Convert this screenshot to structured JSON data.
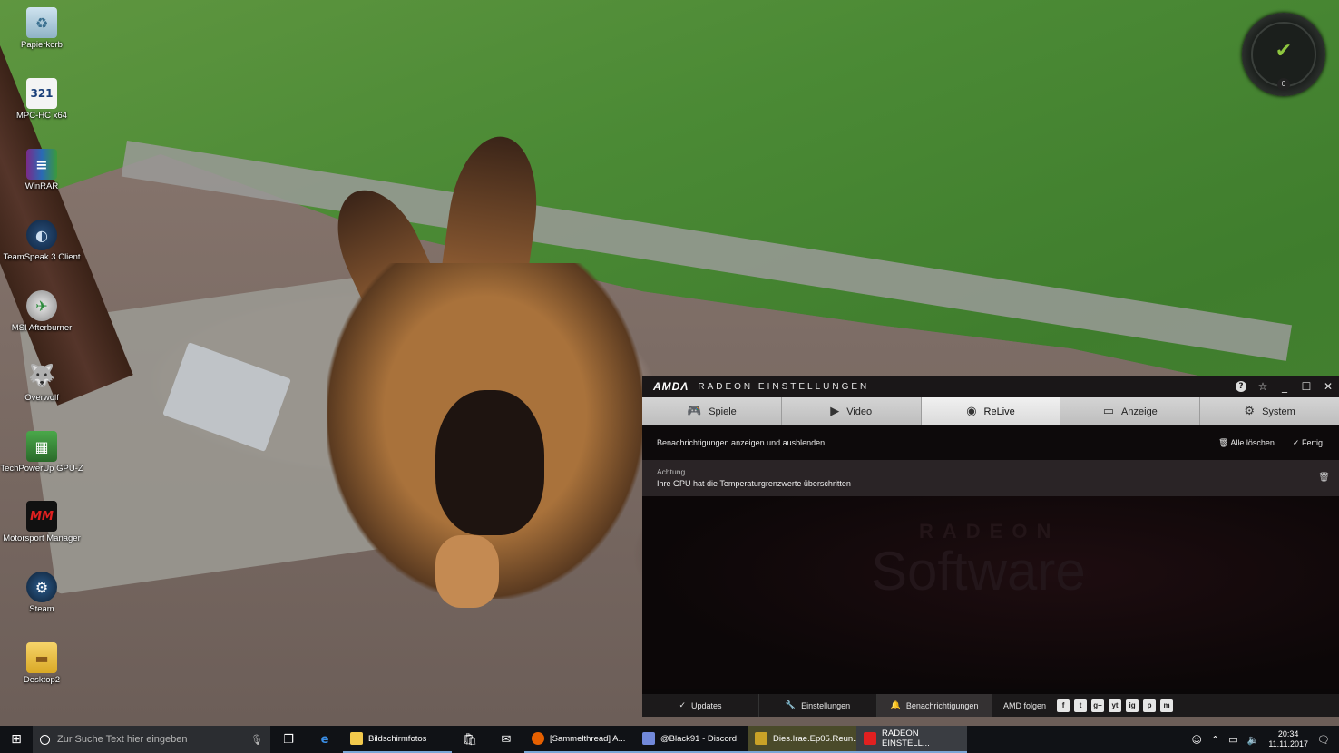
{
  "desktop": {
    "icons": [
      {
        "label": "Papierkorb",
        "icon": "recycle-bin-icon"
      },
      {
        "label": "MPC-HC x64",
        "icon": "mpc-hc-icon"
      },
      {
        "label": "WinRAR",
        "icon": "winrar-icon"
      },
      {
        "label": "TeamSpeak 3 Client",
        "icon": "teamspeak-icon"
      },
      {
        "label": "MSI Afterburner",
        "icon": "msi-afterburner-icon"
      },
      {
        "label": "Overwolf",
        "icon": "overwolf-icon"
      },
      {
        "label": "TechPowerUp GPU-Z",
        "icon": "gpu-z-icon"
      },
      {
        "label": "Motorsport Manager",
        "icon": "motorsport-manager-icon"
      },
      {
        "label": "Steam",
        "icon": "steam-icon"
      },
      {
        "label": "Desktop2",
        "icon": "folder-icon"
      }
    ],
    "widget": {
      "count": "0",
      "accent": "#8ec63f"
    }
  },
  "amd": {
    "logo": "AMDΛ",
    "title": "RADEON EINSTELLUNGEN",
    "tabs": [
      {
        "label": "Spiele",
        "icon": "gamepad-icon"
      },
      {
        "label": "Video",
        "icon": "play-icon"
      },
      {
        "label": "ReLive",
        "icon": "relive-icon"
      },
      {
        "label": "Anzeige",
        "icon": "monitor-icon"
      },
      {
        "label": "System",
        "icon": "system-icon"
      }
    ],
    "active_tab": "ReLive",
    "notifications_hint": "Benachrichtigungen anzeigen und ausblenden.",
    "clear_all": "Alle löschen",
    "done": "Fertig",
    "notification": {
      "title": "Achtung",
      "message": "Ihre GPU hat die Temperaturgrenzwerte überschritten"
    },
    "watermark": {
      "line1": "RADEON",
      "line2": "Software"
    },
    "footer": {
      "updates": "Updates",
      "settings": "Einstellungen",
      "notifications": "Benachrichtigungen",
      "follow": "AMD folgen",
      "social": [
        "f",
        "t",
        "g+",
        "yt",
        "ig",
        "p",
        "m"
      ]
    },
    "accent": "#e02020"
  },
  "taskbar": {
    "search_placeholder": "Zur Suche Text hier eingeben",
    "apps": [
      {
        "label": "Bildschirmfotos",
        "color": "#f2c94c"
      },
      {
        "label": "[Sammelthread] A...",
        "color": "#e66000"
      },
      {
        "label": "@Black91 - Discord",
        "color": "#7289da"
      },
      {
        "label": "Dies.Irae.Ep05.Reun...",
        "color": "#c9a227"
      },
      {
        "label": "RADEON EINSTELL...",
        "color": "#e02020"
      }
    ],
    "time": "20:34",
    "date": "11.11.2017"
  }
}
